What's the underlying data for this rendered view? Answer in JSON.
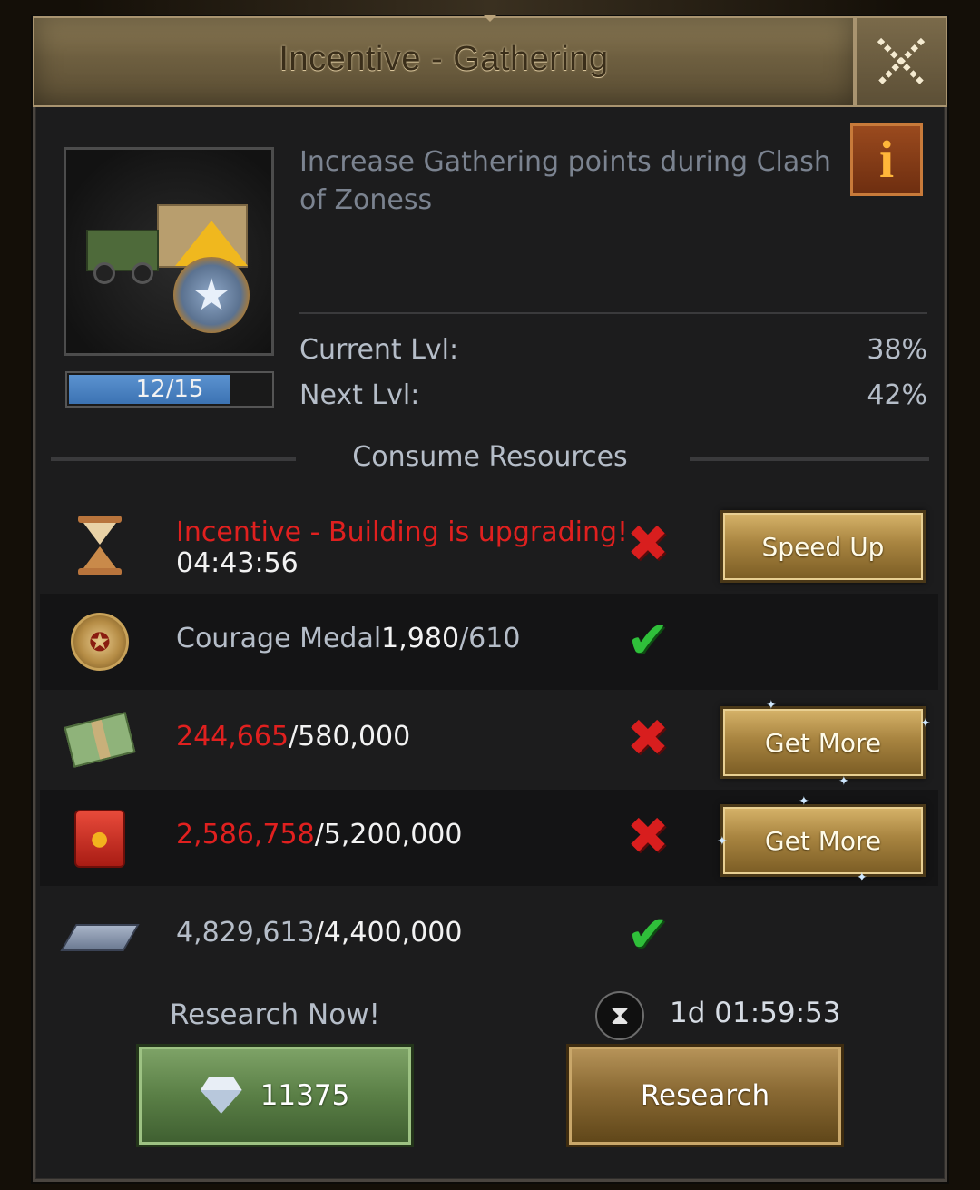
{
  "window": {
    "title": "Incentive - Gathering"
  },
  "skill": {
    "description": "Increase Gathering points during Clash of Zoness",
    "level_text": "12/15",
    "level_progress": 0.8,
    "current_label": "Current Lvl:",
    "current_value": "38%",
    "next_label": "Next Lvl:",
    "next_value": "42%"
  },
  "consume": {
    "heading": "Consume Resources",
    "rows": [
      {
        "icon": "hourglass-icon",
        "text_red": "Incentive - Building is upgrading!",
        "text_sub": "04:43:56",
        "status": "not-met",
        "button": "Speed Up"
      },
      {
        "icon": "courage-medal-icon",
        "name": "Courage Medal",
        "have": "1,980",
        "need": "/610",
        "status": "met"
      },
      {
        "icon": "cash-icon",
        "have": "244,665",
        "need": "/580,000",
        "status": "not-met",
        "button": "Get More"
      },
      {
        "icon": "fuel-icon",
        "have": "2,586,758",
        "need": "/5,200,000",
        "status": "not-met",
        "button": "Get More"
      },
      {
        "icon": "steel-icon",
        "have": "4,829,613",
        "need": "/4,400,000",
        "status": "met"
      }
    ]
  },
  "actions": {
    "research_now_label": "Research Now!",
    "gem_cost": "11375",
    "timer": "1d 01:59:53",
    "research_label": "Research"
  },
  "colors": {
    "red_text": "#e0201f",
    "level_fill": "#3c73b3",
    "check": "#2fbf3a",
    "cross": "#d81e1e"
  }
}
